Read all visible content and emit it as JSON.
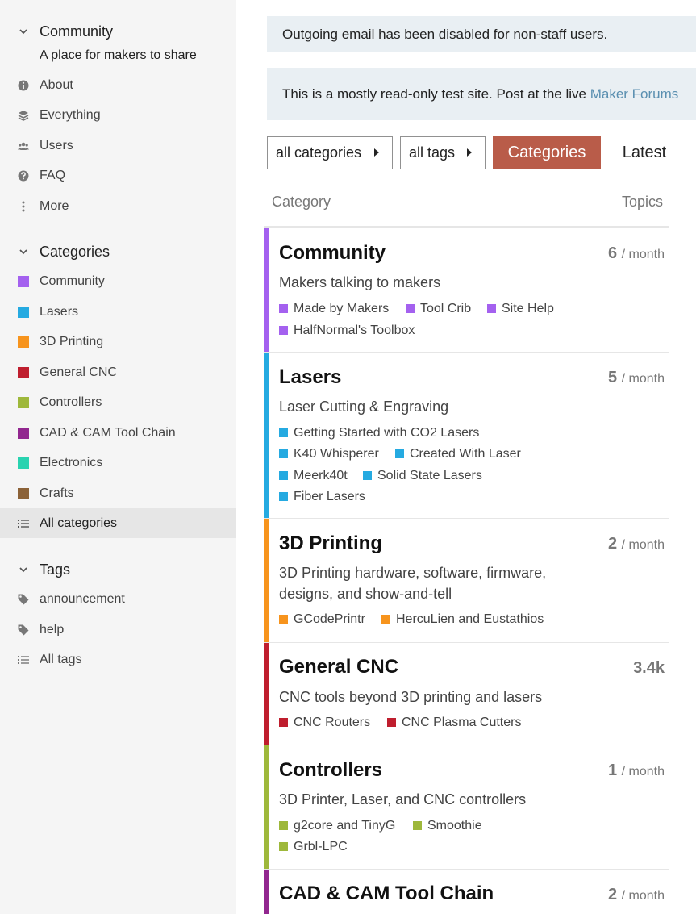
{
  "sidebar": {
    "community_section": {
      "title": "Community",
      "description": "A place for makers to share",
      "items": [
        {
          "label": "About",
          "icon": "info-icon"
        },
        {
          "label": "Everything",
          "icon": "layers-icon"
        },
        {
          "label": "Users",
          "icon": "users-icon"
        },
        {
          "label": "FAQ",
          "icon": "question-icon"
        },
        {
          "label": "More",
          "icon": "ellipsis-vertical-icon"
        }
      ]
    },
    "categories_section": {
      "title": "Categories",
      "items": [
        {
          "label": "Community",
          "color": "#a461ef"
        },
        {
          "label": "Lasers",
          "color": "#25aae1"
        },
        {
          "label": "3D Printing",
          "color": "#f7941d"
        },
        {
          "label": "General CNC",
          "color": "#bf1e2e"
        },
        {
          "label": "Controllers",
          "color": "#9eb83b"
        },
        {
          "label": "CAD & CAM Tool Chain",
          "color": "#92278f"
        },
        {
          "label": "Electronics",
          "color": "#29d3b0"
        },
        {
          "label": "Crafts",
          "color": "#8c6238"
        },
        {
          "label": "All categories",
          "icon": "list-icon",
          "active": true
        }
      ]
    },
    "tags_section": {
      "title": "Tags",
      "items": [
        {
          "label": "announcement",
          "icon": "tag-icon"
        },
        {
          "label": "help",
          "icon": "tag-icon"
        },
        {
          "label": "All tags",
          "icon": "list-icon"
        }
      ]
    }
  },
  "banners": {
    "email_notice": "Outgoing email has been disabled for non-staff users.",
    "readonly_prefix": "This is a mostly read-only test site. Post at the live ",
    "readonly_link": "Maker Forums"
  },
  "filters": {
    "categories_dropdown": "all categories",
    "tags_dropdown": "all tags"
  },
  "nav": {
    "categories": "Categories",
    "latest": "Latest"
  },
  "table": {
    "col_category": "Category",
    "col_topics": "Topics",
    "rows": [
      {
        "name": "Community",
        "color": "#a461ef",
        "description": "Makers talking to makers",
        "count": "6",
        "unit": "/ month",
        "subcategories": [
          "Made by Makers",
          "Tool Crib",
          "Site Help",
          "HalfNormal's Toolbox"
        ]
      },
      {
        "name": "Lasers",
        "color": "#25aae1",
        "description": "Laser Cutting & Engraving",
        "count": "5",
        "unit": "/ month",
        "subcategories": [
          "Getting Started with CO2 Lasers",
          "K40 Whisperer",
          "Created With Laser",
          "Meerk40t",
          "Solid State Lasers",
          "Fiber Lasers"
        ]
      },
      {
        "name": "3D Printing",
        "color": "#f7941d",
        "description": "3D Printing hardware, software, firmware, designs, and show-and-tell",
        "count": "2",
        "unit": "/ month",
        "subcategories": [
          "GCodePrintr",
          "HercuLien and Eustathios"
        ]
      },
      {
        "name": "General CNC",
        "color": "#bf1e2e",
        "description": "CNC tools beyond 3D printing and lasers",
        "count": "3.4k",
        "unit": "",
        "subcategories": [
          "CNC Routers",
          "CNC Plasma Cutters"
        ]
      },
      {
        "name": "Controllers",
        "color": "#9eb83b",
        "description": "3D Printer, Laser, and CNC controllers",
        "count": "1",
        "unit": "/ month",
        "subcategories": [
          "g2core and TinyG",
          "Smoothie",
          "Grbl-LPC"
        ]
      },
      {
        "name": "CAD & CAM Tool Chain",
        "color": "#92278f",
        "description": "",
        "count": "2",
        "unit": "/ month",
        "subcategories": []
      }
    ]
  }
}
